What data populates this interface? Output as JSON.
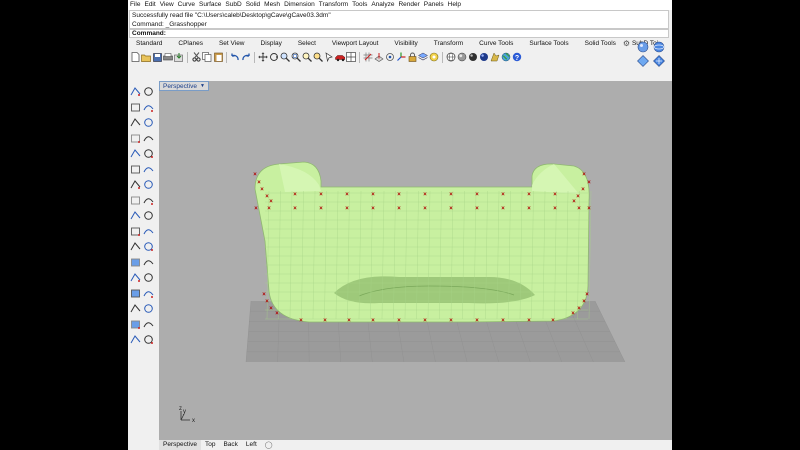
{
  "menu": [
    "File",
    "Edit",
    "View",
    "Curve",
    "Surface",
    "SubD",
    "Solid",
    "Mesh",
    "Dimension",
    "Transform",
    "Tools",
    "Analyze",
    "Render",
    "Panels",
    "Help"
  ],
  "command_history": [
    "Successfully read file \"C:\\Users\\caleb\\Desktop\\gCave\\gCave03.3dm\"",
    "Command: _Grasshopper"
  ],
  "command_prompt": "Command:",
  "toolbar_tabs": [
    "Standard",
    "CPlanes",
    "Set View",
    "Display",
    "Select",
    "Viewport Layout",
    "Visibility",
    "Transform",
    "Curve Tools",
    "Surface Tools",
    "Solid Tools",
    "SubD To’"
  ],
  "viewport": {
    "title": "Perspective",
    "axis_labels": {
      "x": "x",
      "y": "y",
      "z": "z"
    },
    "colors": {
      "background": "#adadad",
      "surface": "#c8f0a0",
      "control_point": "#b00000",
      "grid": "#8f8f8f"
    }
  },
  "viewport_tabs": [
    "Perspective",
    "Top",
    "Back",
    "Left"
  ],
  "icons": {
    "top_toolbar": [
      "new-file-icon",
      "open-file-icon",
      "save-icon",
      "print-icon",
      "import-icon",
      "cut-icon",
      "copy-icon",
      "paste-icon",
      "undo-icon",
      "redo-icon",
      "pan-icon",
      "rotate-view-icon",
      "zoom-icon",
      "zoom-window-icon",
      "zoom-extents-icon",
      "zoom-selected-icon",
      "select-all-icon",
      "car-icon",
      "viewports-icon",
      "grid-icon",
      "cplane-icon",
      "osnap-icon",
      "gumball-icon",
      "lock-icon",
      "layer-icon",
      "properties-icon",
      "wireframe-icon",
      "shaded-icon",
      "rendered-icon",
      "render-icon",
      "material-icon",
      "globe-icon",
      "help-icon"
    ],
    "side_panel": [
      "render-sphere-icon",
      "display-sphere-icon",
      "move-diamond-icon",
      "rotate-diamond-icon"
    ]
  }
}
